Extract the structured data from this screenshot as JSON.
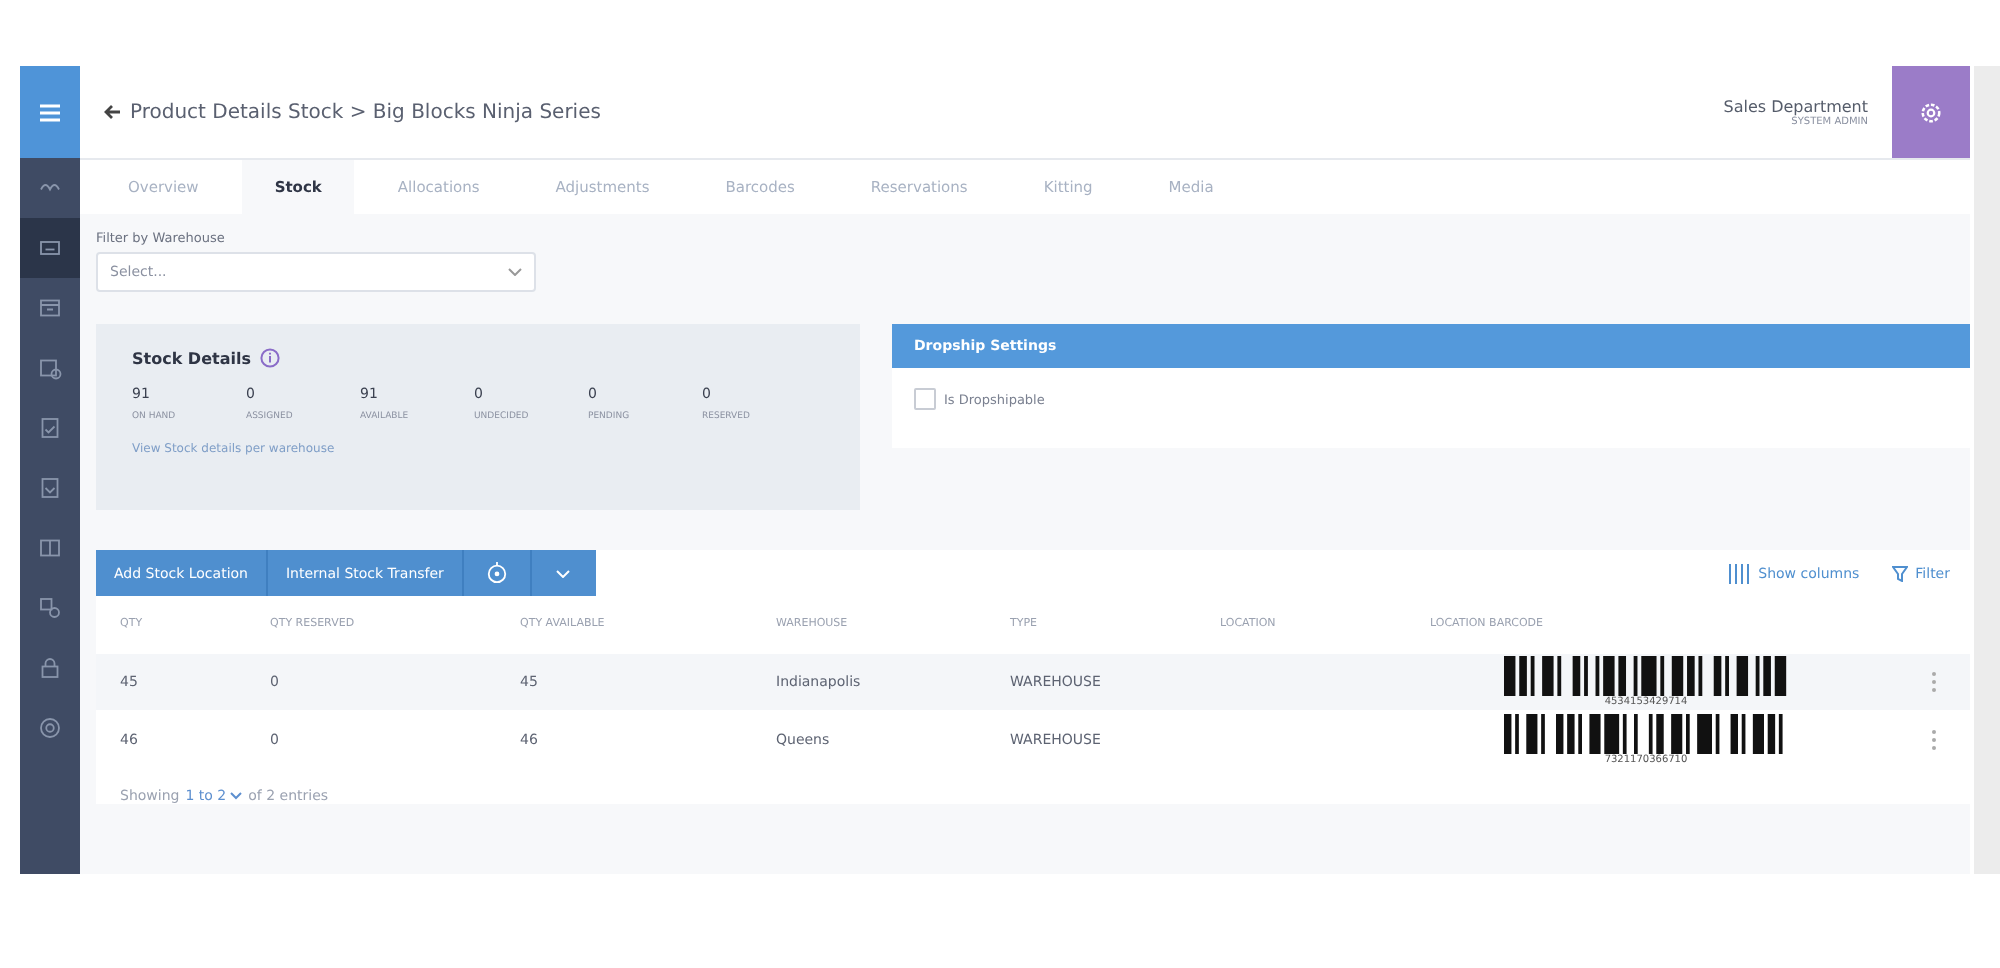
{
  "header": {
    "breadcrumb": "Product Details Stock > Big Blocks Ninja Series",
    "department": "Sales Department",
    "role": "SYSTEM ADMIN"
  },
  "sidebar": {
    "items": [
      {
        "selected": false
      },
      {
        "selected": true
      },
      {
        "selected": false
      },
      {
        "selected": false
      },
      {
        "selected": false
      },
      {
        "selected": false
      },
      {
        "selected": false
      },
      {
        "selected": false
      },
      {
        "selected": false
      },
      {
        "selected": false
      }
    ]
  },
  "tabs": [
    {
      "label": "Overview",
      "selected": false
    },
    {
      "label": "Stock",
      "selected": true
    },
    {
      "label": "Allocations",
      "selected": false
    },
    {
      "label": "Adjustments",
      "selected": false
    },
    {
      "label": "Barcodes",
      "selected": false
    },
    {
      "label": "Reservations",
      "selected": false
    },
    {
      "label": "Kitting",
      "selected": false
    },
    {
      "label": "Media",
      "selected": false
    }
  ],
  "filter": {
    "label": "Filter by Warehouse",
    "placeholder": "Select..."
  },
  "stock_details": {
    "title": "Stock Details",
    "stats": [
      {
        "value": "91",
        "label": "ON HAND"
      },
      {
        "value": "0",
        "label": "ASSIGNED"
      },
      {
        "value": "91",
        "label": "AVAILABLE"
      },
      {
        "value": "0",
        "label": "UNDECIDED"
      },
      {
        "value": "0",
        "label": "PENDING"
      },
      {
        "value": "0",
        "label": "RESERVED"
      }
    ],
    "link": "View Stock details per warehouse"
  },
  "dropship": {
    "title": "Dropship Settings",
    "checkbox": {
      "label": "Is Dropshipable",
      "checked": false
    }
  },
  "toolbar": {
    "buttons": [
      "Add Stock Location",
      "Internal Stock Transfer"
    ],
    "show_columns": "Show columns",
    "filter": "Filter"
  },
  "table": {
    "columns": [
      "QTY",
      "QTY RESERVED",
      "QTY AVAILABLE",
      "WAREHOUSE",
      "TYPE",
      "LOCATION",
      "LOCATION BARCODE"
    ],
    "rows": [
      [
        "45",
        "0",
        "45",
        "Indianapolis",
        "WAREHOUSE",
        "",
        "4534153429714"
      ],
      [
        "46",
        "0",
        "46",
        "Queens",
        "WAREHOUSE",
        "",
        "7321170366710"
      ]
    ]
  },
  "footer": {
    "prefix": "Showing",
    "range": "1 to 2",
    "suffix": "of 2 entries"
  }
}
